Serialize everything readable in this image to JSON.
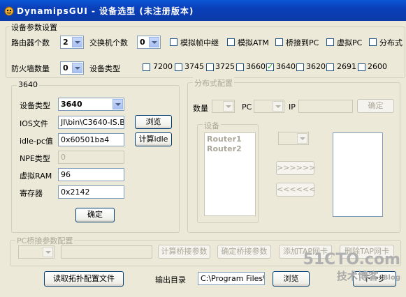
{
  "window": {
    "title": "DynamipsGUI - 设备选型 (未注册版本)"
  },
  "params": {
    "group_title": "设备参数设置",
    "router_count_label": "路由器个数",
    "router_count": "2",
    "switch_count_label": "交换机个数",
    "switch_count": "0",
    "options": [
      {
        "label": "模拟帧中继",
        "checked": false
      },
      {
        "label": "模拟ATM",
        "checked": false
      },
      {
        "label": "桥接到PC",
        "checked": false
      },
      {
        "label": "虚拟PC",
        "checked": false
      },
      {
        "label": "分布式",
        "checked": false
      }
    ],
    "firewall_label": "防火墙数量",
    "firewall_count": "0",
    "device_type_label": "设备类型",
    "models": [
      {
        "label": "7200",
        "checked": false
      },
      {
        "label": "3745",
        "checked": false
      },
      {
        "label": "3725",
        "checked": false
      },
      {
        "label": "3660",
        "checked": false
      },
      {
        "label": "3640",
        "checked": true
      },
      {
        "label": "3620",
        "checked": false
      },
      {
        "label": "2691",
        "checked": false
      },
      {
        "label": "2600",
        "checked": false
      }
    ]
  },
  "model_group": {
    "title": "3640",
    "device_type_label": "设备类型",
    "device_type_value": "3640",
    "ios_label": "IOS文件",
    "ios_value": "JI\\bin\\C3640-IS.BIN",
    "browse_label": "浏览",
    "idlepc_label": "idle-pc值",
    "idlepc_value": "0x60501ba4",
    "calc_idle_label": "计算idle",
    "npe_label": "NPE类型",
    "npe_value": "0",
    "ram_label": "虚拟RAM",
    "ram_value": "96",
    "register_label": "寄存器",
    "register_value": "0x2142",
    "ok_label": "确定"
  },
  "distributed": {
    "title": "分布式配置",
    "qty_label": "数量",
    "pc_label": "PC",
    "ip_label": "IP",
    "ok_label": "确定",
    "devices_title": "设备",
    "devices": [
      "Router1",
      "Router2"
    ],
    "move_right_label": ">>>>>>",
    "move_left_label": "<<<<<<"
  },
  "bridge": {
    "title": "PC桥接参数配置",
    "calc_label": "计算桥接参数",
    "confirm_label": "确定桥接参数",
    "add_tap_label": "添加TAP网卡",
    "remove_tap_label": "删除TAP网卡"
  },
  "footer": {
    "read_topology_label": "读取拓扑配置文件",
    "output_dir_label": "输出目录",
    "output_dir_value": "C:\\Program Files\\Dy",
    "browse_label": "浏览",
    "next_label": "下一步"
  },
  "watermark": {
    "line1": "51CTO.com",
    "line2": "技术博客",
    "line3": "Blog"
  }
}
